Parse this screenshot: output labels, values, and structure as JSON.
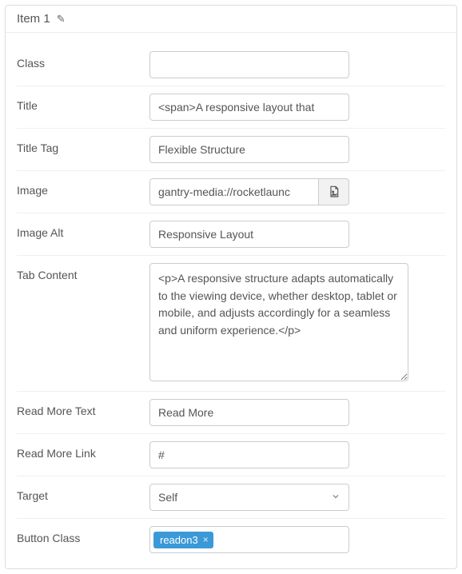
{
  "header": {
    "title": "Item 1"
  },
  "fields": {
    "class": {
      "label": "Class",
      "value": ""
    },
    "title": {
      "label": "Title",
      "value": "<span>A responsive layout that"
    },
    "title_tag": {
      "label": "Title Tag",
      "value": "Flexible Structure"
    },
    "image": {
      "label": "Image",
      "value": "gantry-media://rocketlaunc"
    },
    "image_alt": {
      "label": "Image Alt",
      "value": "Responsive Layout"
    },
    "tab_content": {
      "label": "Tab Content",
      "value": "<p>A responsive structure adapts automatically to the viewing device, whether desktop, tablet or mobile, and adjusts accordingly for a seamless and uniform experience.</p>"
    },
    "read_more_text": {
      "label": "Read More Text",
      "value": "Read More"
    },
    "read_more_link": {
      "label": "Read More Link",
      "value": "#"
    },
    "target": {
      "label": "Target",
      "value": "Self"
    },
    "button_class": {
      "label": "Button Class",
      "tags": [
        "readon3"
      ]
    }
  }
}
